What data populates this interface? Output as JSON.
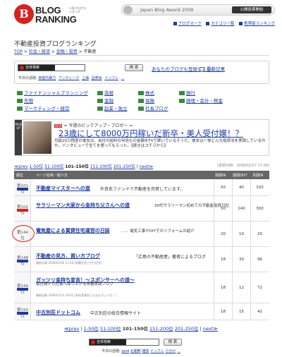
{
  "header": {
    "logo_line1": "BLOG",
    "logo_line2": "RANKING",
    "logo_tag": "人気ブログランキング",
    "award_text": "Japan Blog Award 2008",
    "award_button": "公開投票開始",
    "links": [
      "ブログマーク",
      "カテゴリ一覧",
      "携帯版ランキング"
    ]
  },
  "page_title": "不動産投資ブログランキング",
  "breadcrumb": [
    "TOP",
    "社会・経済",
    "金融・投資",
    "不動産"
  ],
  "search": {
    "box_label": "全体検索",
    "button": "検 索",
    "register": "あなたのブログも登録しよう！",
    "new_articles": "最新記事",
    "today_label": "今日の話題:",
    "today_items": [
      "家庭内暴力",
      "アンティーク",
      "上海",
      "証券会",
      "インフレ",
      "..."
    ]
  },
  "categories": [
    [
      "ファイナンシャルプランニング",
      "為替",
      "株式",
      "銀行"
    ],
    [
      "先物",
      "金融",
      "保険",
      "経理・会計・税金"
    ],
    [
      "マーケティング・経営",
      "起業・独立",
      "社長ブログ"
    ]
  ],
  "pickup": {
    "bar_label": "PICK UP",
    "new_badge": "NEW",
    "head": "= 今週のピックアップ・ブロガー =",
    "title": "23歳にして8000万円稼いだ新卒・美人受付嬢！？",
    "body": "月給20万程度の彼女は、会社の給料の何倍もの金額をFXで稼いでいるそうだ。彼女は一体どんな投資法を実践しているのか。インタビューで全てを語ってもらった。【続きはコチラから】"
  },
  "pager": {
    "prev": "≪prev",
    "ranges": [
      "1-50位",
      "51-100位",
      "101-150位",
      "151-200位",
      "201-250位"
    ],
    "current": "101-150位",
    "next": "next≫",
    "updated": "[更新日時：2008/02/27 17:06]"
  },
  "table": {
    "headers": [
      "順位",
      "ページ名称／紹介文",
      "週間IN",
      "週間OUT",
      "月間IN"
    ],
    "rows": [
      {
        "rank": "第101位",
        "title": "不動産マイスターへの道",
        "desc": "外資系ファンドで不動産を売買しています。",
        "meta": "",
        "in": "50",
        "out": "40",
        "month": "320"
      },
      {
        "rank": "第102位",
        "title": "サラリーマン大家から金持ち父さんへの道",
        "desc": "30代サラリーマン初めての不動産投資日記",
        "meta": "",
        "in": "50",
        "out": "140",
        "month": "300"
      },
      {
        "rank": "第144位",
        "title": "電気屋による賃貸住宅運営の日誌",
        "desc": "...... 電気工事やDIYでのリフォームの紹介",
        "meta": "",
        "in": "20",
        "out": "10",
        "month": "20"
      },
      {
        "rank": "第148位",
        "title": "不動産の見方、買い方ブログ",
        "desc": "「広島の不動産屋」著者によるブログ",
        "meta": "最新記事 2008/02/26 21:28 [新築住宅と中古住宅]",
        "in": "18",
        "out": "30",
        "month": "96"
      },
      {
        "rank": "第149位",
        "title": "ガッツリ金持ち宣言！～スポンサーへの道～",
        "desc": "会社員から社長へ成り上がる青春実践ブログ",
        "meta": "最新記事 2008/02/23 19:01 [青年実業家] [えねるぎょうの...]",
        "in": "18",
        "out": "12",
        "month": "72"
      },
      {
        "rank": "第150位",
        "title": "中古別荘ドットコム",
        "desc": "中古別荘の総合情報サイト",
        "meta": "",
        "in": "18",
        "out": "15",
        "month": "42"
      }
    ]
  },
  "bottom": {
    "pager_text_prev": "≪prev",
    "today_label": "今日の話題:",
    "today_items": [
      "ipod",
      "北朝鮮",
      "雑貨",
      "インフレ",
      "小分け",
      "..."
    ]
  }
}
